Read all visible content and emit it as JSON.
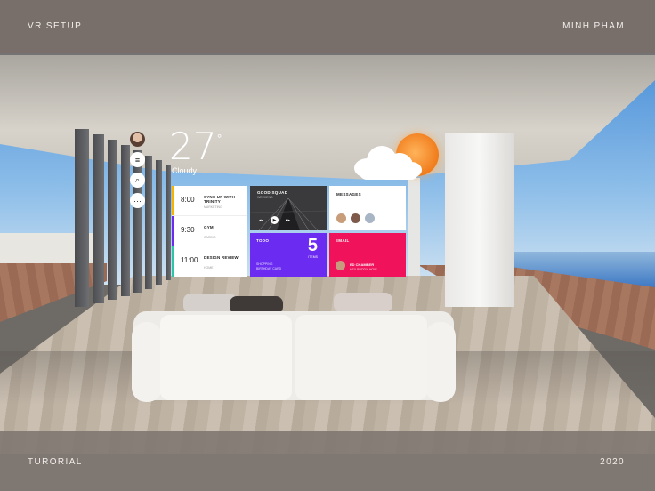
{
  "header": {
    "left": "VR SETUP",
    "right": "MINH PHAM"
  },
  "footer": {
    "left": "TURORIAL",
    "right": "2020"
  },
  "dock": [
    {
      "icon": "avatar"
    },
    {
      "icon": "menu-icon",
      "glyph": "≡"
    },
    {
      "icon": "search-icon",
      "glyph": "⌕"
    },
    {
      "icon": "more-icon",
      "glyph": "···"
    }
  ],
  "weather": {
    "temperature": "27",
    "unit": "°",
    "condition": "Cloudy"
  },
  "schedule": [
    {
      "time": "8:00",
      "title": "SYNC UP WITH TRINITY",
      "sub": "MARKETING",
      "color": "#f6b400"
    },
    {
      "time": "9:30",
      "title": "GYM",
      "sub": "CARDIO",
      "color": "#6b2bf0"
    },
    {
      "time": "11:00",
      "title": "DESIGN REVIEW",
      "sub": "HOME",
      "color": "#2ec4a6"
    }
  ],
  "music": {
    "title": "GOOD SQUAD",
    "sub": "WEEKEND",
    "prev": "◂◂",
    "play": "▶",
    "next": "▸▸"
  },
  "messages": {
    "title": "MESSAGES",
    "avatar_colors": [
      "#c89d7a",
      "#7d5a49",
      "#a7b5c5"
    ]
  },
  "todo": {
    "title": "TODO",
    "count": "5",
    "unit": "ITEMS",
    "line1": "SHOPPING",
    "line2": "BIRTHDAY CARD"
  },
  "email": {
    "title": "EMAIL",
    "from": "ED CHAMBER",
    "sub": "HEY BUDDY, HOW..."
  }
}
